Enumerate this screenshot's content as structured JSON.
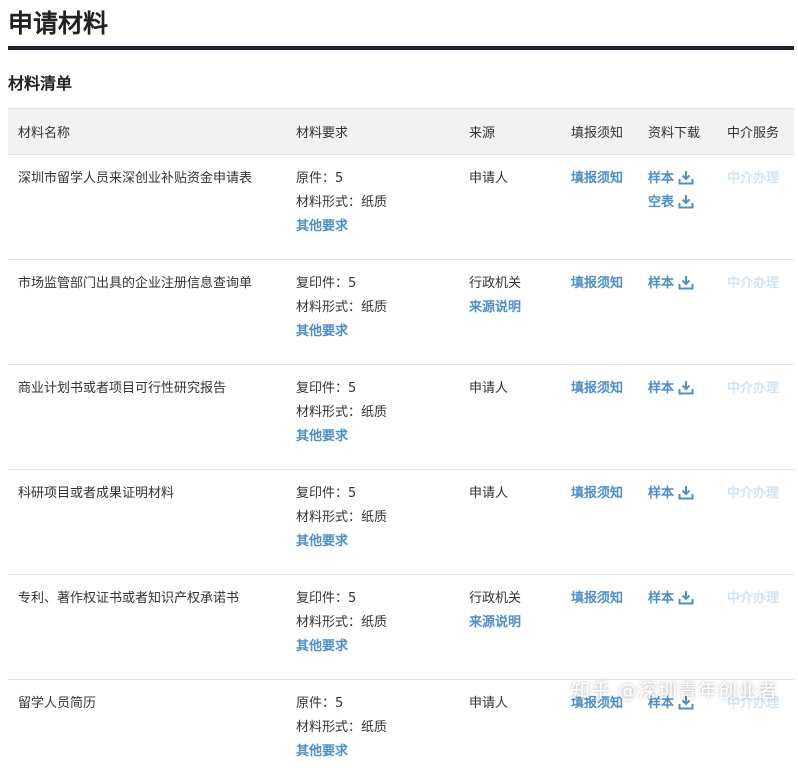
{
  "page": {
    "title": "申请材料",
    "section_title": "材料清单"
  },
  "table": {
    "headers": [
      "材料名称",
      "材料要求",
      "来源",
      "填报须知",
      "资料下载",
      "中介服务"
    ],
    "rows": [
      {
        "name": "深圳市留学人员来深创业补贴资金申请表",
        "copies": "原件：5",
        "form": "材料形式：纸质",
        "other": "其他要求",
        "source": "申请人",
        "source_note": "",
        "notice": "填报须知",
        "downloads": [
          "样本",
          "空表"
        ],
        "agency": "中介办理"
      },
      {
        "name": "市场监管部门出具的企业注册信息查询单",
        "copies": "复印件：5",
        "form": "材料形式：纸质",
        "other": "其他要求",
        "source": "行政机关",
        "source_note": "来源说明",
        "notice": "填报须知",
        "downloads": [
          "样本"
        ],
        "agency": "中介办理"
      },
      {
        "name": "商业计划书或者项目可行性研究报告",
        "copies": "复印件：5",
        "form": "材料形式：纸质",
        "other": "其他要求",
        "source": "申请人",
        "source_note": "",
        "notice": "填报须知",
        "downloads": [
          "样本"
        ],
        "agency": "中介办理"
      },
      {
        "name": "科研项目或者成果证明材料",
        "copies": "复印件：5",
        "form": "材料形式：纸质",
        "other": "其他要求",
        "source": "申请人",
        "source_note": "",
        "notice": "填报须知",
        "downloads": [
          "样本"
        ],
        "agency": "中介办理"
      },
      {
        "name": "专利、著作权证书或者知识产权承诺书",
        "copies": "复印件：5",
        "form": "材料形式：纸质",
        "other": "其他要求",
        "source": "行政机关",
        "source_note": "来源说明",
        "notice": "填报须知",
        "downloads": [
          "样本"
        ],
        "agency": "中介办理"
      },
      {
        "name": "留学人员简历",
        "copies": "原件：5",
        "form": "材料形式：纸质",
        "other": "其他要求",
        "source": "申请人",
        "source_note": "",
        "notice": "填报须知",
        "downloads": [
          "样本"
        ],
        "agency": "中介办理"
      }
    ]
  },
  "icons": {
    "download": "download-icon"
  },
  "colors": {
    "link": "#4d8fc9",
    "agency_disabled": "#d3e4f2",
    "header_bg": "#f2f2f2",
    "title_rule": "#1b2430"
  },
  "watermark": "知乎 @深圳青年创业者"
}
